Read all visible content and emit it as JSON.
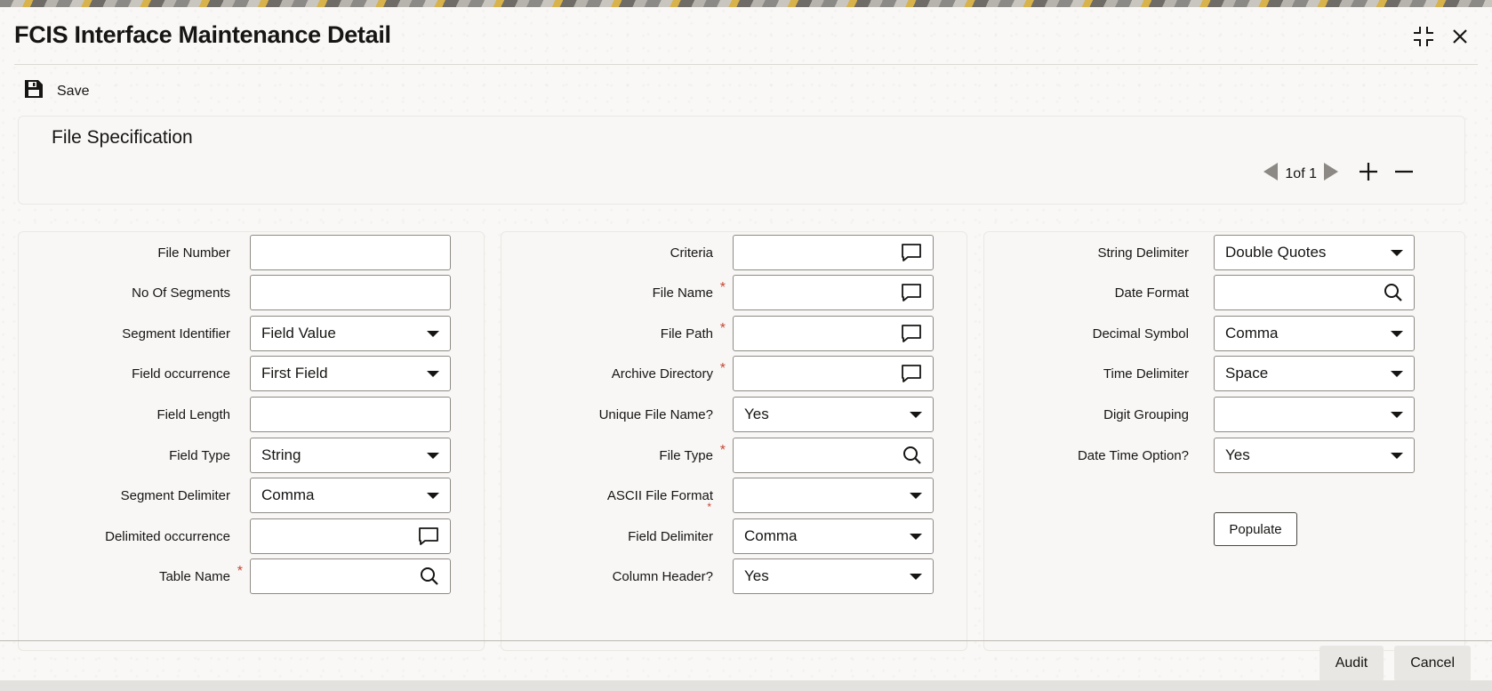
{
  "window": {
    "title": "FCIS Interface Maintenance Detail"
  },
  "toolbar": {
    "save_label": "Save"
  },
  "file_spec": {
    "heading": "File Specification",
    "pager": {
      "text": "1of 1"
    }
  },
  "col1": {
    "file_number": {
      "label": "File Number",
      "value": ""
    },
    "no_of_segments": {
      "label": "No Of Segments",
      "value": ""
    },
    "segment_identifier": {
      "label": "Segment Identifier",
      "value": "Field Value"
    },
    "field_occurrence": {
      "label": "Field occurrence",
      "value": "First Field"
    },
    "field_length": {
      "label": "Field Length",
      "value": ""
    },
    "field_type": {
      "label": "Field Type",
      "value": "String"
    },
    "segment_delimiter": {
      "label": "Segment Delimiter",
      "value": "Comma"
    },
    "delimited_occurrence": {
      "label": "Delimited occurrence",
      "value": ""
    },
    "table_name": {
      "label": "Table Name",
      "value": "",
      "required": "*"
    }
  },
  "col2": {
    "criteria": {
      "label": "Criteria",
      "value": ""
    },
    "file_name": {
      "label": "File Name",
      "value": "",
      "required": "*"
    },
    "file_path": {
      "label": "File Path",
      "value": "",
      "required": "*"
    },
    "archive_directory": {
      "label": "Archive Directory",
      "value": "",
      "required": "*"
    },
    "unique_file_name": {
      "label": "Unique File Name?",
      "value": "Yes"
    },
    "file_type": {
      "label": "File Type",
      "value": "",
      "required": "*"
    },
    "ascii_file_format": {
      "label": "ASCII File Format",
      "value": "",
      "required": "*"
    },
    "field_delimiter": {
      "label": "Field Delimiter",
      "value": "Comma"
    },
    "column_header": {
      "label": "Column Header?",
      "value": "Yes"
    }
  },
  "col3": {
    "string_delimiter": {
      "label": "String Delimiter",
      "value": "Double Quotes"
    },
    "date_format": {
      "label": "Date Format",
      "value": ""
    },
    "decimal_symbol": {
      "label": "Decimal Symbol",
      "value": "Comma"
    },
    "time_delimiter": {
      "label": "Time Delimiter",
      "value": "Space"
    },
    "digit_grouping": {
      "label": "Digit Grouping",
      "value": ""
    },
    "date_time_option": {
      "label": "Date Time Option?",
      "value": "Yes"
    },
    "populate_label": "Populate"
  },
  "footer": {
    "audit_label": "Audit",
    "cancel_label": "Cancel"
  },
  "colors": {
    "required": "#c74634",
    "text": "#161513",
    "panel": "#f8f7f5"
  }
}
